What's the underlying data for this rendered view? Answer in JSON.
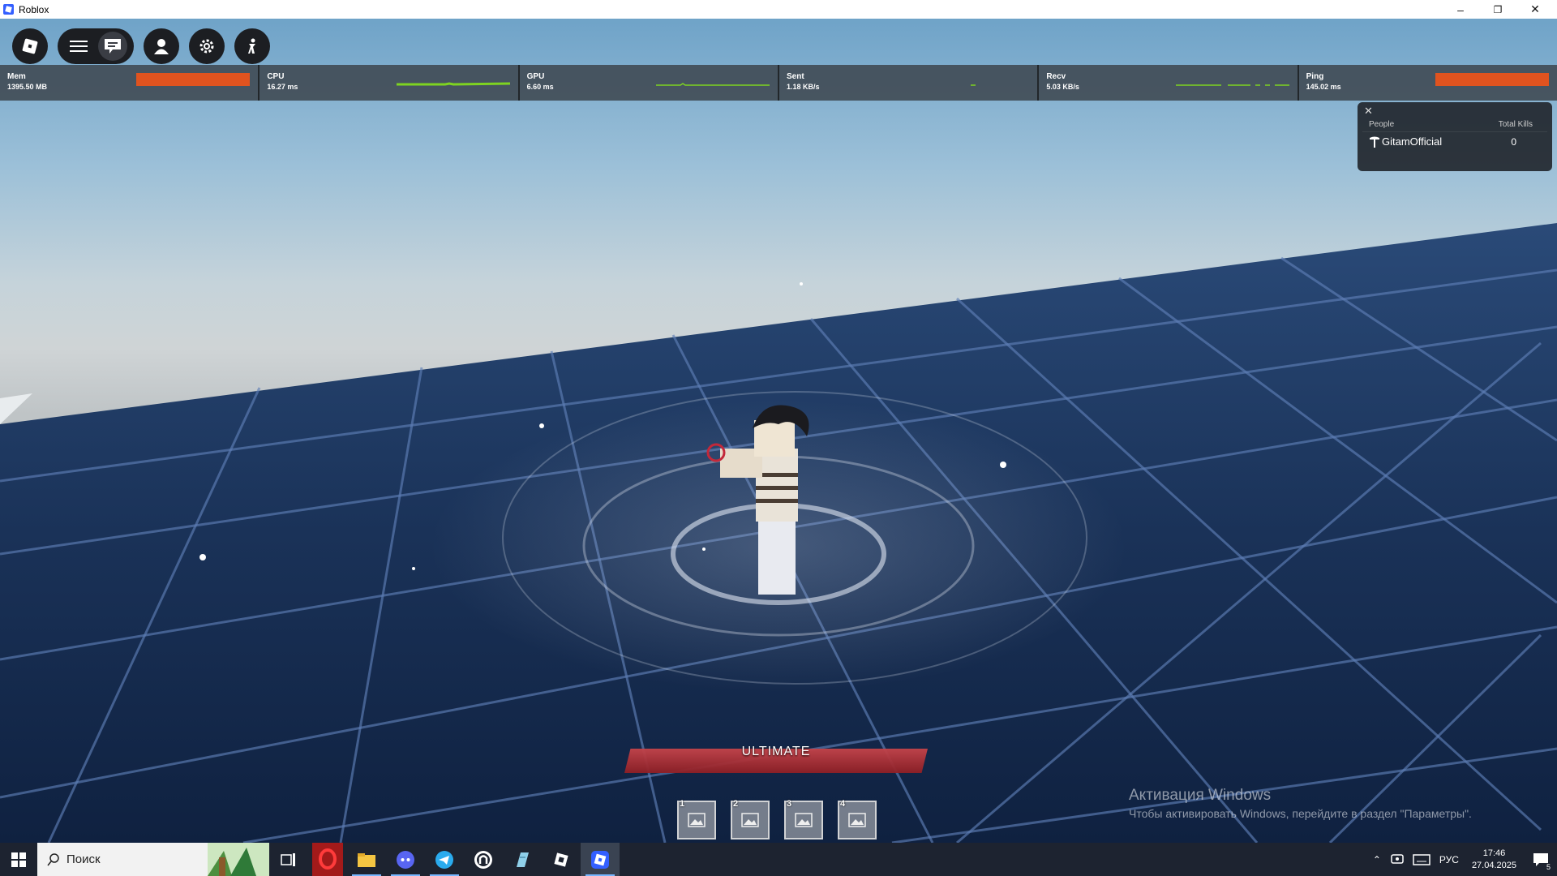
{
  "window": {
    "title": "Roblox",
    "buttons": {
      "minimize": "–",
      "restore": "❐",
      "close": "✕"
    }
  },
  "topbar": {
    "icons": [
      "roblox-logo-icon",
      "menu-icon",
      "chat-icon",
      "avatar-icon",
      "settings-icon",
      "emote-icon"
    ]
  },
  "stats": [
    {
      "label": "Mem",
      "value": "1395.50 MB",
      "display": "bar",
      "color": "#e0531f"
    },
    {
      "label": "CPU",
      "value": "16.27 ms",
      "display": "graph",
      "color": "#7ed321"
    },
    {
      "label": "GPU",
      "value": "6.60 ms",
      "display": "graph",
      "color": "#7ed321"
    },
    {
      "label": "Sent",
      "value": "1.18 KB/s",
      "display": "graph",
      "color": "#7ed321"
    },
    {
      "label": "Recv",
      "value": "5.03 KB/s",
      "display": "graph",
      "color": "#7ed321"
    },
    {
      "label": "Ping",
      "value": "145.02 ms",
      "display": "bar",
      "color": "#e0531f"
    }
  ],
  "leaderboard": {
    "close": "✕",
    "col_people": "People",
    "col_kills": "Total Kills",
    "players": [
      {
        "name": "GitamOfficial",
        "kills": "0"
      }
    ]
  },
  "ultimate": {
    "label": "ULTIMATE",
    "color": "#b83238"
  },
  "hotbar": {
    "slots": [
      "1",
      "2",
      "3",
      "4"
    ]
  },
  "activation": {
    "title": "Активация Windows",
    "subtitle": "Чтобы активировать Windows, перейдите в раздел \"Параметры\"."
  },
  "taskbar": {
    "search_placeholder": "Поиск",
    "apps": [
      "task-view-icon",
      "opera-icon",
      "file-explorer-icon",
      "discord-icon",
      "telegram-icon",
      "obs-icon",
      "notepad-icon",
      "roblox-studio-icon",
      "roblox-icon"
    ],
    "language": "РУС",
    "time": "17:46",
    "date": "27.04.2025",
    "notifications": "5"
  }
}
